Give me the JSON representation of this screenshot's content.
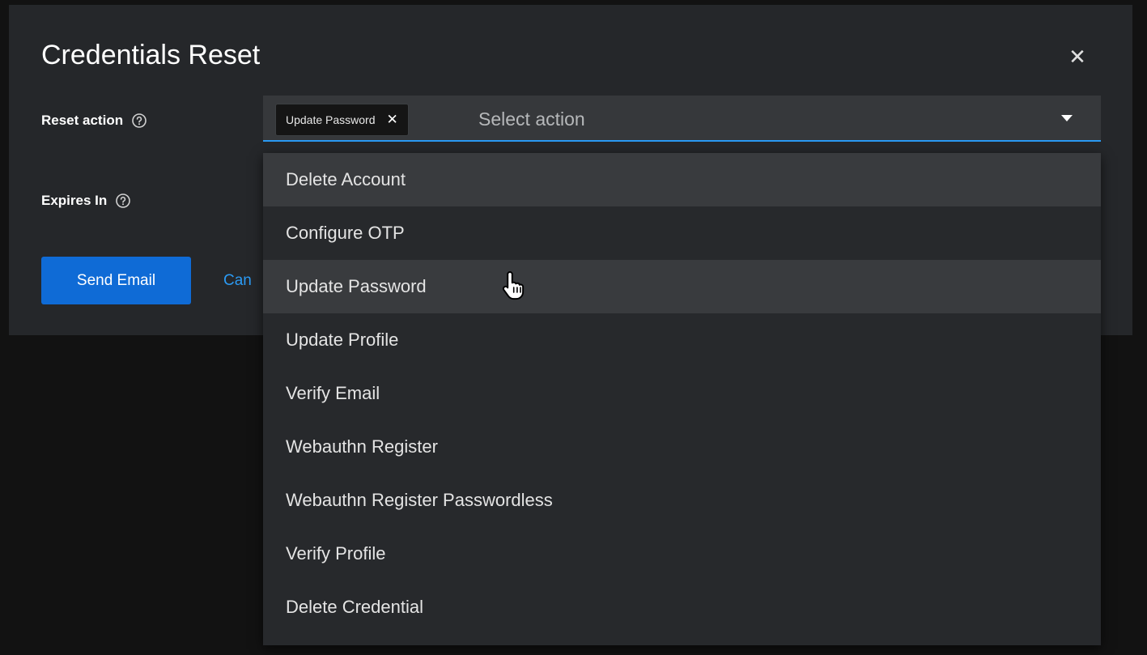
{
  "modal": {
    "title": "Credentials Reset",
    "close_icon": "close-icon"
  },
  "form": {
    "reset_action": {
      "label": "Reset action",
      "help_icon": "help-icon",
      "chips": [
        "Update Password"
      ],
      "placeholder": "Select action"
    },
    "expires_in": {
      "label": "Expires In",
      "help_icon": "help-icon"
    }
  },
  "actions": {
    "primary_label": "Send Email",
    "cancel_label": "Can"
  },
  "dropdown": {
    "items": [
      "Delete Account",
      "Configure OTP",
      "Update Password",
      "Update Profile",
      "Verify Email",
      "Webauthn Register",
      "Webauthn Register Passwordless",
      "Verify Profile",
      "Delete Credential"
    ],
    "hovered": [
      "Delete Account",
      "Update Password"
    ]
  },
  "colors": {
    "accent": "#0f6bd6",
    "link": "#2b9af3",
    "modal_bg": "#25272a",
    "menu_bg": "#27292c",
    "hover_bg": "#393b3e"
  }
}
